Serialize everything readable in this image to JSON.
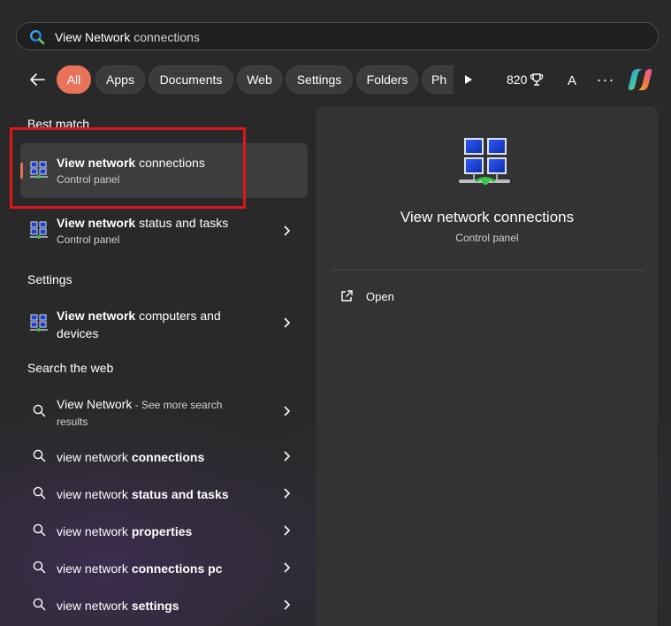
{
  "search": {
    "typed": "View Network",
    "suggestion_rest": " connections"
  },
  "filters": [
    {
      "label": "All",
      "active": true
    },
    {
      "label": "Apps"
    },
    {
      "label": "Documents"
    },
    {
      "label": "Web"
    },
    {
      "label": "Settings"
    },
    {
      "label": "Folders"
    },
    {
      "label": "Ph"
    }
  ],
  "rewards": {
    "points": "820"
  },
  "account": {
    "initial": "A"
  },
  "more": {
    "label": "···"
  },
  "best_match": {
    "label": "Best match",
    "items": [
      {
        "title_bold": "View network",
        "title_rest": " connections",
        "subtitle": "Control panel"
      },
      {
        "title_bold": "View network",
        "title_rest": " status and tasks",
        "subtitle": "Control panel"
      }
    ]
  },
  "settings_section": {
    "label": "Settings",
    "item": {
      "title_bold": "View network",
      "title_rest": " computers and",
      "title_line2": "devices"
    }
  },
  "web_section": {
    "label": "Search the web",
    "first": {
      "query": "View Network",
      "see_more": " - See more search",
      "see_more_2": "results"
    },
    "items": [
      {
        "plain": "view network ",
        "bold": "connections"
      },
      {
        "plain": "view network ",
        "bold": "status and tasks"
      },
      {
        "plain": "view network ",
        "bold": "properties"
      },
      {
        "plain": "view network ",
        "bold": "connections pc"
      },
      {
        "plain": "view network ",
        "bold": "settings"
      }
    ]
  },
  "detail": {
    "title": "View network connections",
    "subtitle": "Control panel",
    "action_open": "Open"
  },
  "colors": {
    "accent": "#e9735a",
    "annotation": "#e0161f",
    "background": "#292929",
    "panel": "#333333"
  }
}
